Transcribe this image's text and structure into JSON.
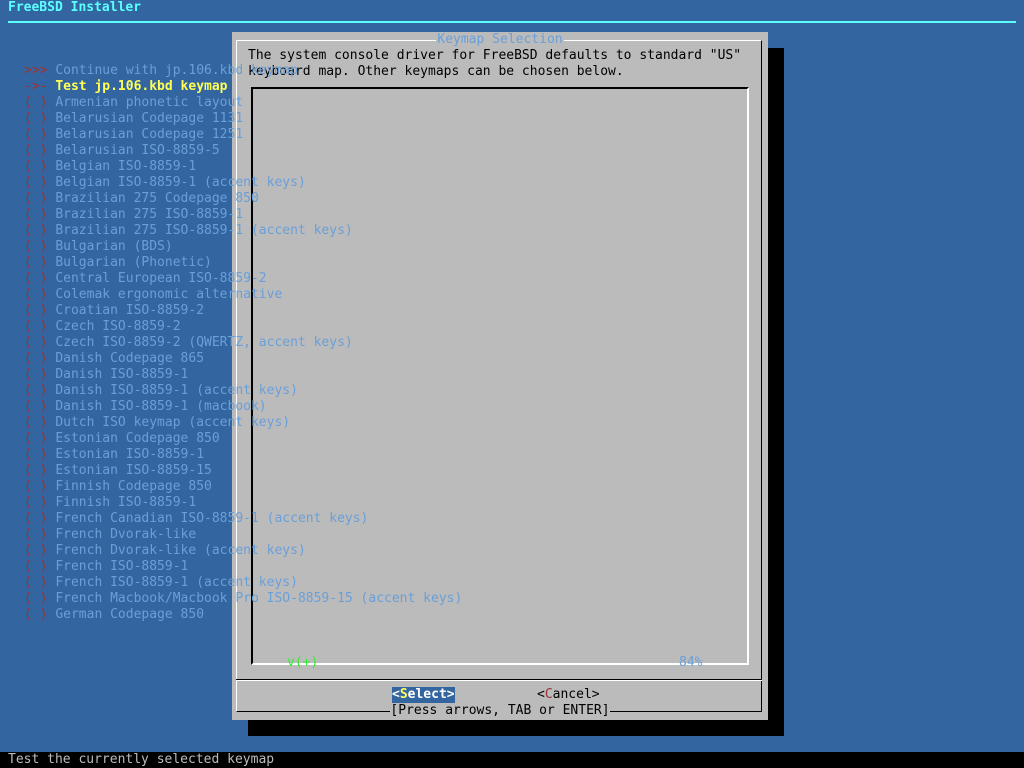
{
  "app_title": "FreeBSD Installer",
  "dialog": {
    "title": "Keymap Selection",
    "prompt": "The system console driver for FreeBSD defaults to standard \"US\"\nkeyboard map. Other keymaps can be chosen below.",
    "items": [
      {
        "mark": ">>>",
        "label": "Continue with jp.106.kbd keymap",
        "selected": false
      },
      {
        "mark": "->-",
        "label": "Test jp.106.kbd keymap",
        "selected": true
      },
      {
        "mark": "( )",
        "label": "Armenian phonetic layout",
        "selected": false
      },
      {
        "mark": "( )",
        "label": "Belarusian Codepage 1131",
        "selected": false
      },
      {
        "mark": "( )",
        "label": "Belarusian Codepage 1251",
        "selected": false
      },
      {
        "mark": "( )",
        "label": "Belarusian ISO-8859-5",
        "selected": false
      },
      {
        "mark": "( )",
        "label": "Belgian ISO-8859-1",
        "selected": false
      },
      {
        "mark": "( )",
        "label": "Belgian ISO-8859-1 (accent keys)",
        "selected": false
      },
      {
        "mark": "( )",
        "label": "Brazilian 275 Codepage 850",
        "selected": false
      },
      {
        "mark": "( )",
        "label": "Brazilian 275 ISO-8859-1",
        "selected": false
      },
      {
        "mark": "( )",
        "label": "Brazilian 275 ISO-8859-1 (accent keys)",
        "selected": false
      },
      {
        "mark": "( )",
        "label": "Bulgarian (BDS)",
        "selected": false
      },
      {
        "mark": "( )",
        "label": "Bulgarian (Phonetic)",
        "selected": false
      },
      {
        "mark": "( )",
        "label": "Central European ISO-8859-2",
        "selected": false
      },
      {
        "mark": "( )",
        "label": "Colemak ergonomic alternative",
        "selected": false
      },
      {
        "mark": "( )",
        "label": "Croatian ISO-8859-2",
        "selected": false
      },
      {
        "mark": "( )",
        "label": "Czech ISO-8859-2",
        "selected": false
      },
      {
        "mark": "( )",
        "label": "Czech ISO-8859-2 (QWERTZ, accent keys)",
        "selected": false
      },
      {
        "mark": "( )",
        "label": "Danish Codepage 865",
        "selected": false
      },
      {
        "mark": "( )",
        "label": "Danish ISO-8859-1",
        "selected": false
      },
      {
        "mark": "( )",
        "label": "Danish ISO-8859-1 (accent keys)",
        "selected": false
      },
      {
        "mark": "( )",
        "label": "Danish ISO-8859-1 (macbook)",
        "selected": false
      },
      {
        "mark": "( )",
        "label": "Dutch ISO keymap (accent keys)",
        "selected": false
      },
      {
        "mark": "( )",
        "label": "Estonian Codepage 850",
        "selected": false
      },
      {
        "mark": "( )",
        "label": "Estonian ISO-8859-1",
        "selected": false
      },
      {
        "mark": "( )",
        "label": "Estonian ISO-8859-15",
        "selected": false
      },
      {
        "mark": "( )",
        "label": "Finnish Codepage 850",
        "selected": false
      },
      {
        "mark": "( )",
        "label": "Finnish ISO-8859-1",
        "selected": false
      },
      {
        "mark": "( )",
        "label": "French Canadian ISO-8859-1 (accent keys)",
        "selected": false
      },
      {
        "mark": "( )",
        "label": "French Dvorak-like",
        "selected": false
      },
      {
        "mark": "( )",
        "label": "French Dvorak-like (accent keys)",
        "selected": false
      },
      {
        "mark": "( )",
        "label": "French ISO-8859-1",
        "selected": false
      },
      {
        "mark": "( )",
        "label": "French ISO-8859-1 (accent keys)",
        "selected": false
      },
      {
        "mark": "( )",
        "label": "French Macbook/Macbook Pro ISO-8859-15 (accent keys)",
        "selected": false
      },
      {
        "mark": "( )",
        "label": "German Codepage 850",
        "selected": false
      }
    ],
    "scroll_indicator": "v(+)",
    "scroll_percent": "84%",
    "buttons": {
      "select": {
        "open": "<",
        "hot": "S",
        "rest": "elect",
        "close": ">"
      },
      "cancel": {
        "open": "<",
        "hot": "C",
        "rest": "ancel",
        "close": ">"
      }
    },
    "hint": "[Press arrows, TAB or ENTER]"
  },
  "status_bar": "Test the currently selected keymap",
  "colors": {
    "background": "#3366a0",
    "dialog": "#bbbbbb",
    "title": "#5cffff",
    "item_text": "#6a9fd8",
    "highlight_text": "#ffff55"
  }
}
